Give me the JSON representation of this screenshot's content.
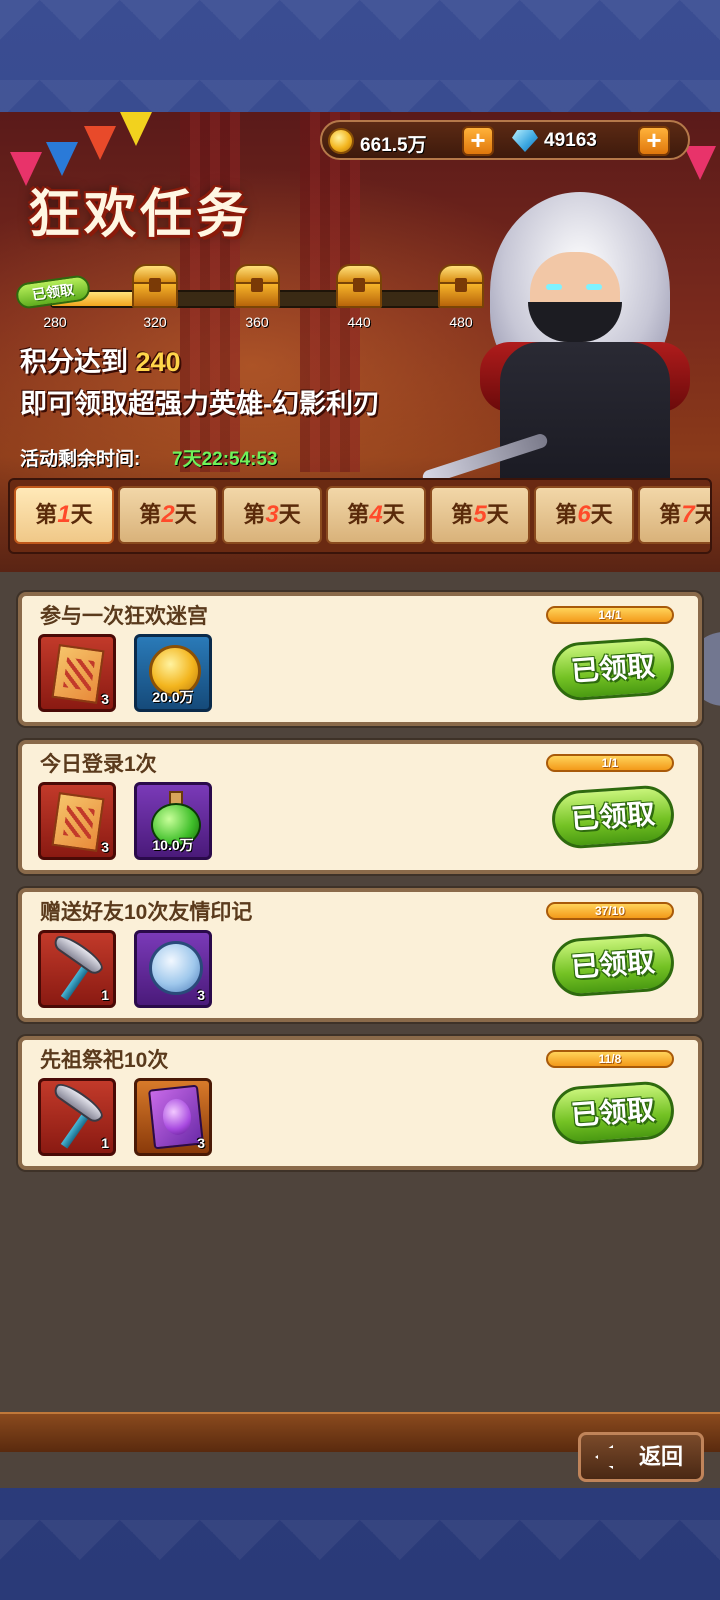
{
  "header": {
    "title": "狂欢任务",
    "gold": "661.5万",
    "gems": "49163",
    "score_prefix": "积分达到",
    "score_value": "240",
    "hero_text": "即可领取超强力英雄-幻影利刃",
    "timer_label": "活动剩余时间:",
    "timer_value": "7天22:54:53",
    "claimed_stamp": "已领取"
  },
  "milestones": [
    {
      "points": "280",
      "claimed": true
    },
    {
      "points": "320",
      "claimed": false
    },
    {
      "points": "360",
      "claimed": false
    },
    {
      "points": "440",
      "claimed": false
    },
    {
      "points": "480",
      "claimed": false
    }
  ],
  "milestone_progress": 0.25,
  "tabs": [
    {
      "prefix": "第",
      "day": "1",
      "suffix": "天",
      "active": true
    },
    {
      "prefix": "第",
      "day": "2",
      "suffix": "天",
      "active": false
    },
    {
      "prefix": "第",
      "day": "3",
      "suffix": "天",
      "active": false
    },
    {
      "prefix": "第",
      "day": "4",
      "suffix": "天",
      "active": false
    },
    {
      "prefix": "第",
      "day": "5",
      "suffix": "天",
      "active": false
    },
    {
      "prefix": "第",
      "day": "6",
      "suffix": "天",
      "active": false
    },
    {
      "prefix": "第",
      "day": "7",
      "suffix": "天",
      "active": false
    }
  ],
  "tasks": [
    {
      "title": "参与一次狂欢迷宫",
      "progress": "14/1",
      "button": "已领取",
      "rewards": [
        {
          "icon": "scroll-icon",
          "qty": "3"
        },
        {
          "icon": "gold-coin-icon",
          "qty": "20.0万"
        }
      ]
    },
    {
      "title": "今日登录1次",
      "progress": "1/1",
      "button": "已领取",
      "rewards": [
        {
          "icon": "scroll-icon",
          "qty": "3"
        },
        {
          "icon": "potion-icon",
          "qty": "10.0万"
        }
      ]
    },
    {
      "title": "赠送好友10次友情印记",
      "progress": "37/10",
      "button": "已领取",
      "rewards": [
        {
          "icon": "pickaxe-icon",
          "qty": "1"
        },
        {
          "icon": "friendship-medal-icon",
          "qty": "3"
        }
      ]
    },
    {
      "title": "先祖祭祀10次",
      "progress": "11/8",
      "button": "已领取",
      "rewards": [
        {
          "icon": "pickaxe-icon",
          "qty": "1"
        },
        {
          "icon": "egg-card-icon",
          "qty": "3"
        }
      ]
    }
  ],
  "back_button": "返回",
  "colors": {
    "accent_gold": "#f3a51e",
    "claimed_green": "#74c224",
    "timer_green": "#6ff25a",
    "panel_cream": "#fbf0d8"
  }
}
